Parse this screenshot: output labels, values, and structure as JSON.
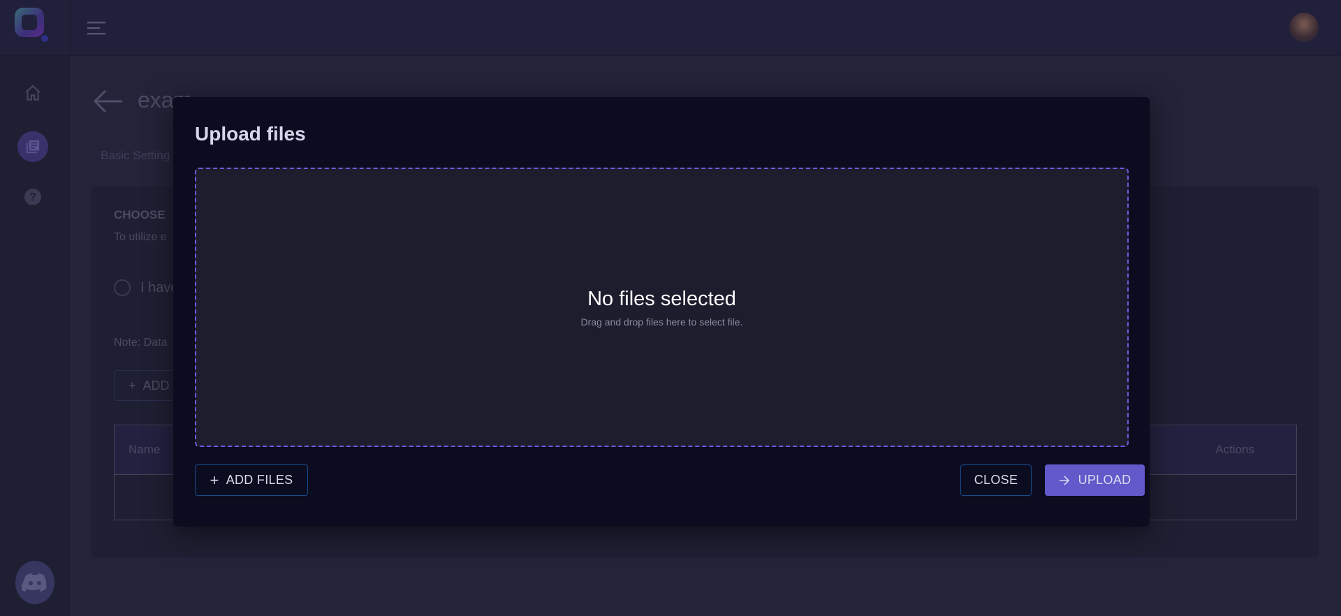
{
  "topbar": {
    "menu_icon": "hamburger-icon",
    "avatar": "user-avatar"
  },
  "sidebar": {
    "items": [
      {
        "icon": "home-icon"
      },
      {
        "icon": "library-icon",
        "active": true
      },
      {
        "icon": "help-icon"
      }
    ],
    "discord_icon": "discord-icon"
  },
  "page": {
    "title": "exam",
    "tab": "Basic Setting",
    "section_title": "CHOOSE",
    "section_desc": "To utilize e",
    "radio_label": "I have",
    "note": "Note: Data",
    "add_button": "ADD",
    "table": {
      "columns": [
        "Name",
        "Actions"
      ]
    }
  },
  "dialog": {
    "title": "Upload files",
    "dropzone": {
      "title": "No files selected",
      "subtitle": "Drag and drop files here to select file."
    },
    "add_files": "ADD FILES",
    "close": "CLOSE",
    "upload": "UPLOAD"
  },
  "colors": {
    "accent": "#6259cb",
    "dashed_border": "#6a5ce0",
    "dialog_bg": "#0c0c20"
  }
}
